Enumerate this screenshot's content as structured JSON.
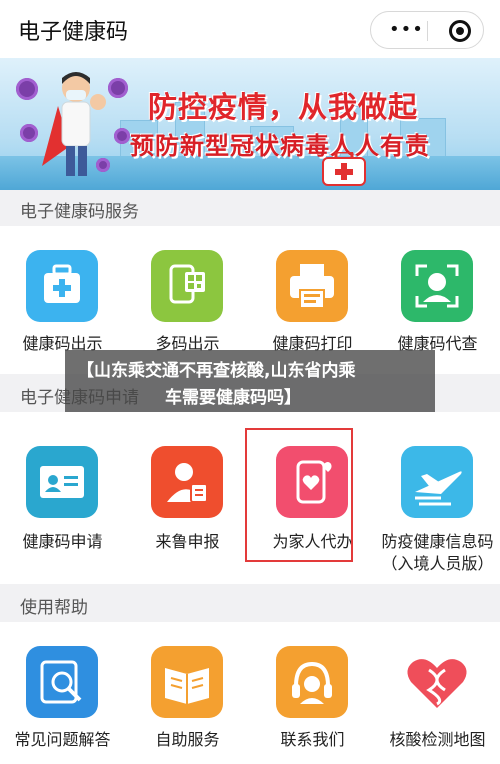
{
  "header": {
    "title": "电子健康码"
  },
  "banner": {
    "line1": "防控疫情，从我做起",
    "line2": "预防新型冠状病毒人人有责"
  },
  "sections": [
    {
      "title": "电子健康码服务",
      "items": [
        {
          "label": "健康码出示",
          "icon": "medical-kit-icon",
          "color": "#3cb3ef"
        },
        {
          "label": "多码出示",
          "icon": "multi-qr-code-icon",
          "color": "#8cc63f"
        },
        {
          "label": "健康码打印",
          "icon": "printer-icon",
          "color": "#f4a030"
        },
        {
          "label": "健康码代查",
          "icon": "face-scan-icon",
          "color": "#2db86a"
        }
      ]
    },
    {
      "title": "电子健康码申请",
      "items": [
        {
          "label": "健康码申请",
          "icon": "id-card-icon",
          "color": "#2aa7cf"
        },
        {
          "label": "来鲁申报",
          "icon": "person-document-icon",
          "color": "#ef4e2e"
        },
        {
          "label": "为家人代办",
          "icon": "phone-heart-icon",
          "color": "#f24e6e"
        },
        {
          "label": "防疫健康信息码",
          "sub": "（入境人员版）",
          "icon": "airplane-icon",
          "color": "#3cb8e8"
        }
      ]
    },
    {
      "title": "使用帮助",
      "items": [
        {
          "label": "常见问题解答",
          "icon": "magnifier-icon",
          "color": "#2f8fe0"
        },
        {
          "label": "自助服务",
          "icon": "book-icon",
          "color": "#f4a030"
        },
        {
          "label": "联系我们",
          "icon": "headset-icon",
          "color": "#f4a030"
        },
        {
          "label": "核酸检测地图",
          "icon": "dna-heart-icon",
          "color": "#ef4e5a"
        }
      ]
    }
  ],
  "overlay": {
    "line1": "【山东乘交通不再查核酸,山东省内乘",
    "line2": "车需要健康码吗】"
  }
}
